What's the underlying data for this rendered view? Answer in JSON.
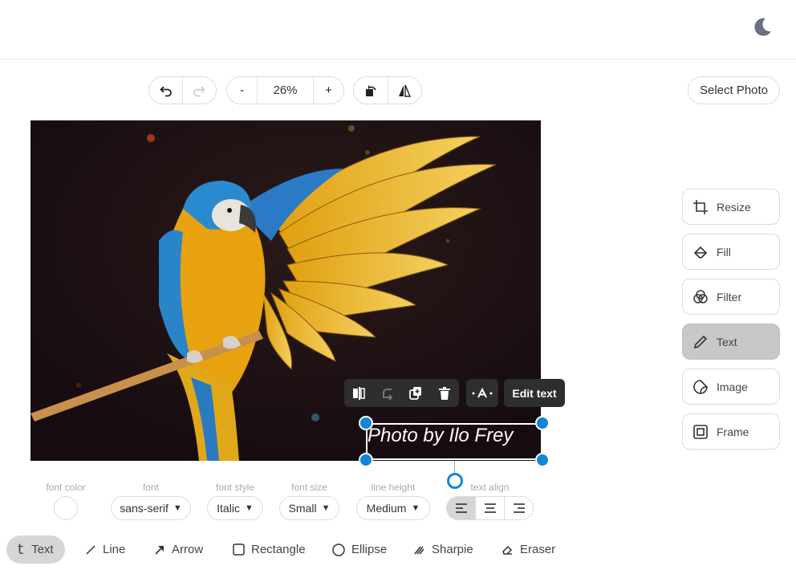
{
  "toolbar": {
    "zoom": "26%",
    "zoom_out": "-",
    "zoom_in": "+",
    "select_photo": "Select Photo"
  },
  "sidebar": {
    "items": [
      {
        "label": "Resize",
        "icon": "crop-icon"
      },
      {
        "label": "Fill",
        "icon": "fill-bucket-icon"
      },
      {
        "label": "Filter",
        "icon": "filter-circles-icon"
      },
      {
        "label": "Text",
        "icon": "pencil-icon",
        "active": true
      },
      {
        "label": "Image",
        "icon": "sticker-icon"
      },
      {
        "label": "Frame",
        "icon": "frame-icon"
      }
    ]
  },
  "canvas": {
    "text_overlay": "Photo by Ilo Frey",
    "edit_text_label": "Edit text"
  },
  "text_options": {
    "font_color_label": "font color",
    "font_label": "font",
    "font_value": "sans-serif",
    "font_style_label": "font style",
    "font_style_value": "Italic",
    "font_size_label": "font size",
    "font_size_value": "Small",
    "line_height_label": "line height",
    "line_height_value": "Medium",
    "text_align_label": "text align"
  },
  "tools": [
    {
      "label": "Text",
      "active": true
    },
    {
      "label": "Line"
    },
    {
      "label": "Arrow"
    },
    {
      "label": "Rectangle"
    },
    {
      "label": "Ellipse"
    },
    {
      "label": "Sharpie"
    },
    {
      "label": "Eraser"
    }
  ],
  "colors": {
    "accent": "#1185d8",
    "canvas_bg": "#1b0f14",
    "floating_bar": "#2e2e2e",
    "active_bg": "#d6d6d6"
  }
}
